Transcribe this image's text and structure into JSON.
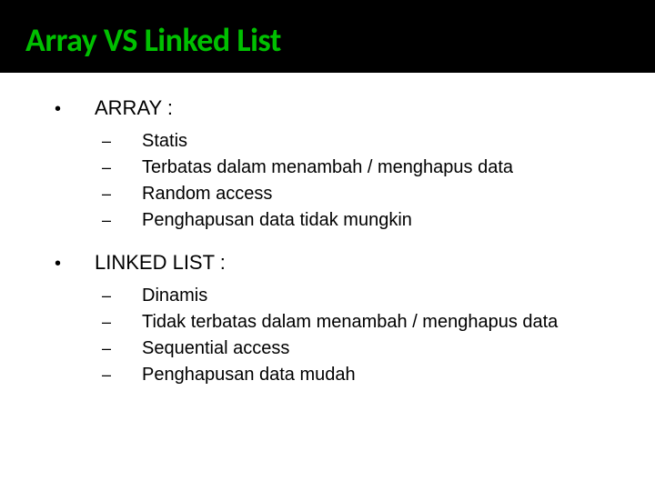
{
  "title": "Array VS Linked List",
  "sections": [
    {
      "label": "ARRAY :",
      "items": [
        "Statis",
        "Terbatas dalam menambah / menghapus data",
        "Random access",
        "Penghapusan data tidak mungkin"
      ]
    },
    {
      "label": "LINKED LIST :",
      "items": [
        "Dinamis",
        "Tidak terbatas dalam menambah / menghapus data",
        "Sequential access",
        "Penghapusan data mudah"
      ]
    }
  ],
  "bullets": {
    "main": "•",
    "sub": "–"
  }
}
